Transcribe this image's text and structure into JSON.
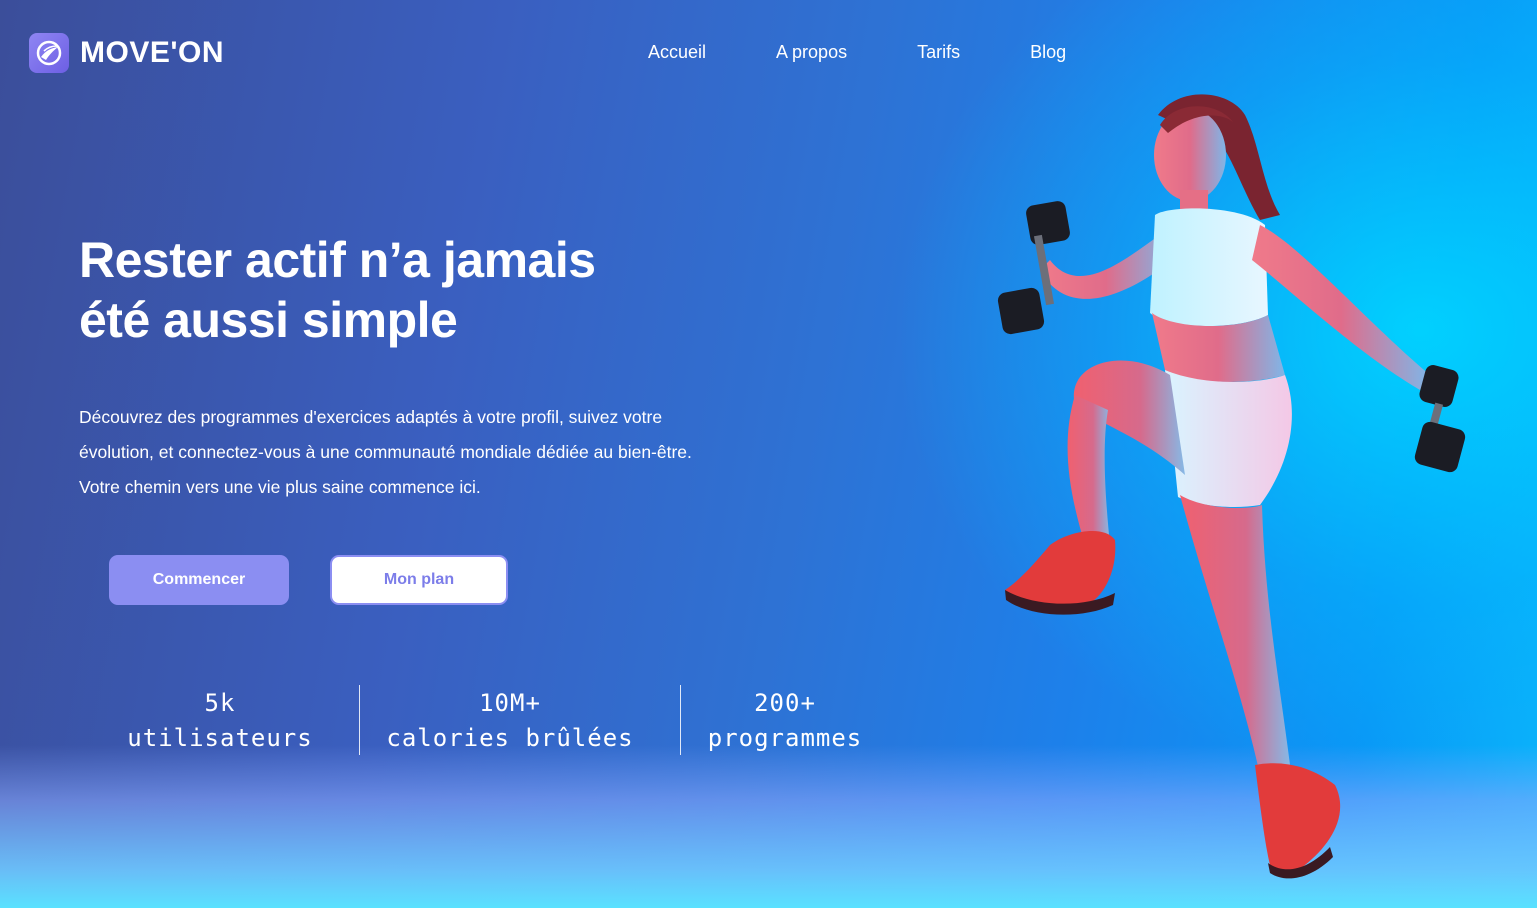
{
  "brand": {
    "name": "MOVE'ON",
    "logo_icon": "moveon-logo-icon",
    "logo_color": "#7b6ff0"
  },
  "nav": {
    "items": [
      {
        "label": "Accueil"
      },
      {
        "label": "A propos"
      },
      {
        "label": "Tarifs"
      },
      {
        "label": "Blog"
      }
    ]
  },
  "hero": {
    "title_line1": "Rester actif n’a jamais",
    "title_line2": "été aussi simple",
    "description_line1": "Découvrez des programmes d'exercices adaptés à votre profil, suivez votre",
    "description_line2": "évolution, et connectez-vous à une communauté mondiale dédiée au bien-être.",
    "description_line3": "Votre chemin vers une vie plus saine commence ici.",
    "primary_button": "Commencer",
    "secondary_button": "Mon plan"
  },
  "stats": [
    {
      "value": "5k",
      "label": "utilisateurs"
    },
    {
      "value": "10M+",
      "label": "calories brûlées"
    },
    {
      "value": "200+",
      "label": "programmes"
    }
  ],
  "colors": {
    "accent": "#8b8ef2",
    "background_left": "#3b4e9a",
    "background_right": "#0bb4fb"
  },
  "illustration": "woman-lifting-dumbbells-image"
}
